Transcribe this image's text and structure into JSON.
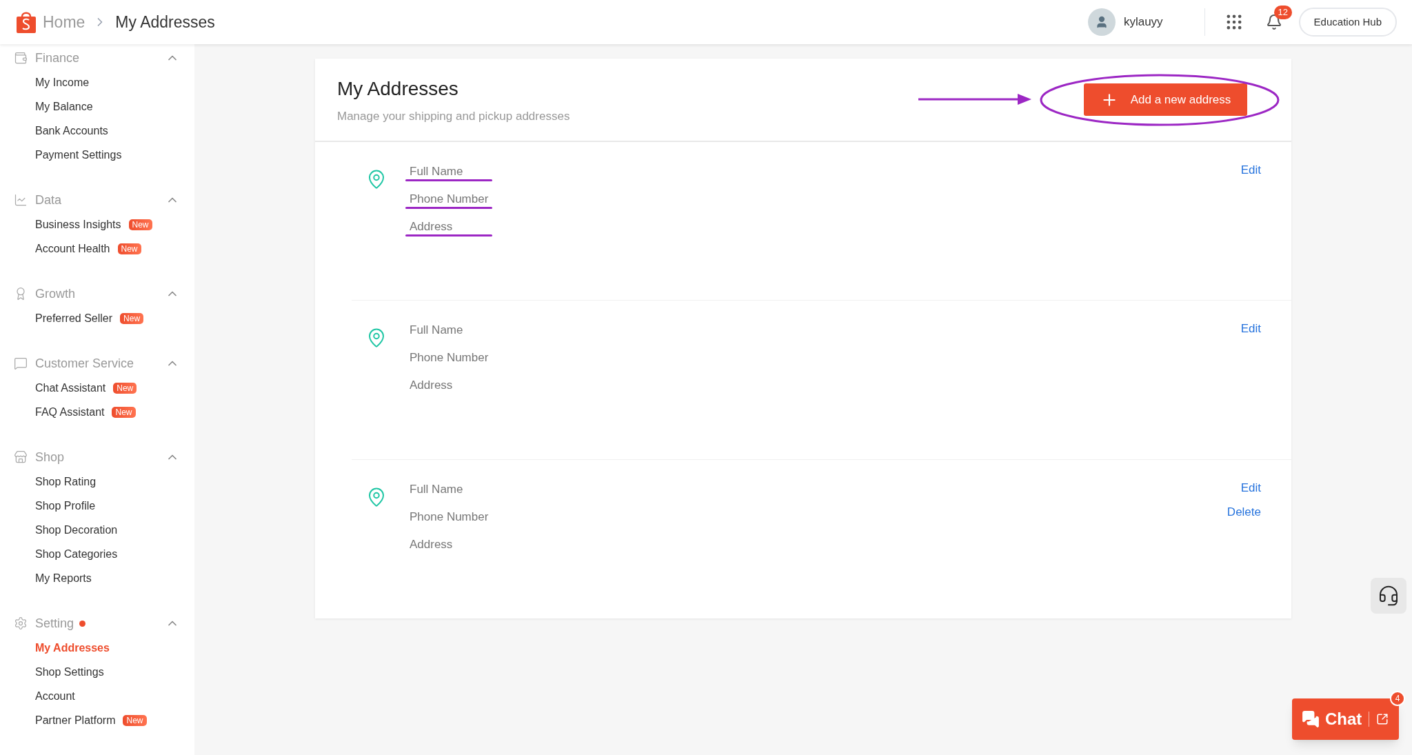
{
  "topbar": {
    "breadcrumb": [
      {
        "label": "Home",
        "current": false
      },
      {
        "label": "My Addresses",
        "current": true
      }
    ],
    "user": {
      "name": "kylauyy"
    },
    "notifications": {
      "count": "12"
    },
    "education_hub": "Education Hub"
  },
  "sidebar": {
    "sections": [
      {
        "title": "Finance",
        "expanded": true,
        "items": [
          {
            "label": "My Income",
            "selected": false
          },
          {
            "label": "My Balance",
            "selected": false
          },
          {
            "label": "Bank Accounts",
            "selected": false
          },
          {
            "label": "Payment Settings",
            "selected": false
          }
        ]
      },
      {
        "title": "Data",
        "expanded": true,
        "items": [
          {
            "label": "Business Insights",
            "selected": false,
            "badge": "New"
          },
          {
            "label": "Account Health",
            "selected": false,
            "badge": "New"
          }
        ]
      },
      {
        "title": "Growth",
        "expanded": true,
        "items": [
          {
            "label": "Preferred Seller",
            "selected": false,
            "badge": "New"
          }
        ]
      },
      {
        "title": "Customer Service",
        "expanded": true,
        "items": [
          {
            "label": "Chat Assistant",
            "selected": false,
            "badge": "New"
          },
          {
            "label": "FAQ Assistant",
            "selected": false,
            "badge": "New"
          }
        ]
      },
      {
        "title": "Shop",
        "expanded": true,
        "items": [
          {
            "label": "Shop Rating",
            "selected": false
          },
          {
            "label": "Shop Profile",
            "selected": false
          },
          {
            "label": "Shop Decoration",
            "selected": false
          },
          {
            "label": "Shop Categories",
            "selected": false
          },
          {
            "label": "My Reports",
            "selected": false
          }
        ]
      },
      {
        "title": "Setting",
        "expanded": true,
        "dot": true,
        "items": [
          {
            "label": "My Addresses",
            "selected": true
          },
          {
            "label": "Shop Settings",
            "selected": false
          },
          {
            "label": "Account",
            "selected": false
          },
          {
            "label": "Partner Platform",
            "selected": false,
            "badge": "New"
          }
        ]
      }
    ]
  },
  "card": {
    "title": "My Addresses",
    "subtitle": "Manage your shipping and pickup addresses",
    "add_button": {
      "label": "Add a new address",
      "annotated": true
    },
    "addresses": [
      {
        "underlined": true,
        "fields": [
          "Full Name",
          "Phone Number",
          "Address"
        ],
        "actions": [
          "Edit"
        ]
      },
      {
        "underlined": false,
        "fields": [
          "Full Name",
          "Phone Number",
          "Address"
        ],
        "actions": [
          "Edit"
        ]
      },
      {
        "underlined": false,
        "fields": [
          "Full Name",
          "Phone Number",
          "Address"
        ],
        "actions": [
          "Edit",
          "Delete"
        ]
      }
    ]
  },
  "chat": {
    "label": "Chat",
    "badge": "4"
  }
}
